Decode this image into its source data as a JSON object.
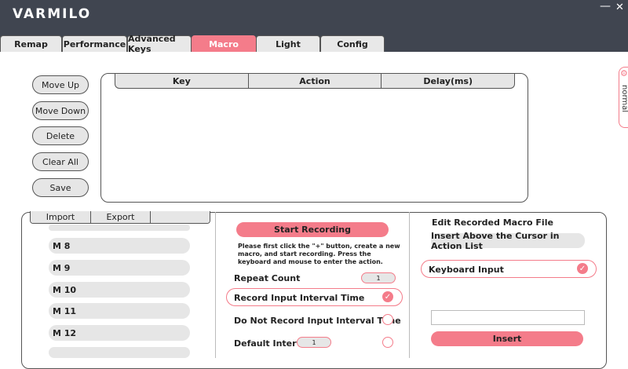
{
  "app": {
    "logo": "VARMILO",
    "minimize": "—",
    "close": "✕"
  },
  "tabs": [
    {
      "label": "Remap",
      "active": false
    },
    {
      "label": "Performance",
      "active": false
    },
    {
      "label": "Advanced Keys",
      "active": false
    },
    {
      "label": "Macro",
      "active": true
    },
    {
      "label": "Light",
      "active": false
    },
    {
      "label": "Config",
      "active": false
    }
  ],
  "side_buttons": {
    "move_up": "Move Up",
    "move_down": "Move Down",
    "delete": "Delete",
    "clear_all": "Clear All",
    "save": "Save"
  },
  "action_table": {
    "columns": [
      "Key",
      "Action",
      "Delay(ms)"
    ]
  },
  "right_edge": {
    "label": "normal",
    "icon": "gear-icon"
  },
  "macro_list": {
    "import": "Import",
    "export": "Export",
    "items": [
      "M 8",
      "M 9",
      "M 10",
      "M 11",
      "M 12"
    ]
  },
  "recording": {
    "start": "Start Recording",
    "hint": "Please first click the \"+\" button, create a new macro, and start recording. Press the keyboard and mouse to enter the action.",
    "repeat_count_label": "Repeat Count",
    "repeat_count_value": "1",
    "record_interval": "Record Input Interval Time",
    "no_record_interval": "Do Not Record Input Interval Time",
    "default_interval_label": "Default Interval",
    "default_interval_value": "1"
  },
  "edit": {
    "title": "Edit Recorded Macro File",
    "insert_above": "Insert Above the Cursor in Action List",
    "keyboard_input": "Keyboard Input",
    "insert_value": "",
    "insert": "Insert"
  },
  "colors": {
    "accent": "#f47c8a",
    "titlebar": "#404550"
  }
}
